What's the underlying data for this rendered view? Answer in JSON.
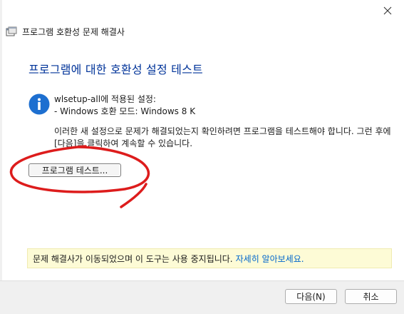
{
  "window": {
    "title": "프로그램 호환성 문제 해결사",
    "close_symbol": "✕"
  },
  "main": {
    "heading": "프로그램에 대한 호환성 설정 테스트",
    "applied_header": "wlsetup-all에 적용된 설정:",
    "applied_item": "- Windows 호환 모드: Windows 8 K",
    "description": "이러한 새 설정으로 문제가 해결되었는지 확인하려면 프로그램을 테스트해야 합니다. 그런 후에 [다음]을 클릭하여 계속할 수 있습니다.",
    "test_button": "프로그램 테스트..."
  },
  "notice": {
    "text": "문제 해결사가 이동되었으며 이 도구는 사용 중지됩니다.",
    "link": "자세히 알아보세요."
  },
  "footer": {
    "next_label": "다음(N)",
    "cancel_label": "취소"
  },
  "icons": {
    "app": "troubleshooter-icon",
    "info": "info-icon",
    "close": "close-icon"
  },
  "colors": {
    "heading": "#003399",
    "info_icon": "#1d6fd0",
    "notice_bg": "#fdfbd6",
    "link": "#0066cc",
    "annotation": "#dd1c1c"
  }
}
